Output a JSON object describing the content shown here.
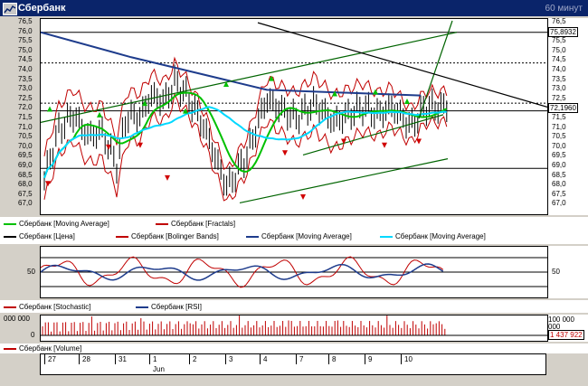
{
  "window": {
    "title": "Сбербанк",
    "timeframe": "60 минут"
  },
  "price_panel": {
    "y_ticks": [
      "76,5",
      "76,0",
      "75,5",
      "75,0",
      "74,5",
      "74,0",
      "73,5",
      "73,0",
      "72,5",
      "72,0",
      "71,5",
      "71,0",
      "70,5",
      "70,0",
      "69,5",
      "69,0",
      "68,5",
      "68,0",
      "67,5",
      "67,0"
    ],
    "left_ticks": [
      "76,5",
      "76,0",
      "75,5",
      "75,0",
      "74,5",
      "74,0",
      "73,5",
      "73,0",
      "72,5",
      "72,0",
      "71,5",
      "71,0",
      "70,5",
      "70,0",
      "69,5",
      "69,0",
      "68,5",
      "68,0",
      "67,5",
      "67,0"
    ],
    "last_price_top": "75,8932",
    "last_price": "72,1960"
  },
  "legend": [
    {
      "label": "Сбербанк [Moving Average]",
      "color": "#00c000"
    },
    {
      "label": "Сбербанк [Fractals]",
      "color": "#c00000"
    },
    {
      "label": "Сбербанк [Цена]",
      "color": "#000000"
    },
    {
      "label": "Сбербанк [Bolinger Bands]",
      "color": "#c00000"
    },
    {
      "label": "Сбербанк [Moving Average]",
      "color": "#1e3c8c"
    },
    {
      "label": "Сбербанк [Moving Average]",
      "color": "#00d8ff"
    }
  ],
  "oscillator_panel": {
    "tick": "50",
    "right_tick": "50",
    "legend": [
      {
        "label": "Сбербанк [Stochastic]",
        "color": "#c00000"
      },
      {
        "label": "Сбербанк [RSI]",
        "color": "#1e3c8c"
      }
    ]
  },
  "volume_panel": {
    "left_top": "000 000",
    "left_zero": "0",
    "right_top": "100 000 000",
    "right_zero": "0",
    "last_value": "1 437 922",
    "legend": [
      {
        "label": "Сбербанк [Volume]",
        "color": "#c00000"
      }
    ]
  },
  "date_axis": {
    "days": [
      "27",
      "28",
      "31",
      "1",
      "2",
      "3",
      "4",
      "7",
      "8",
      "9",
      "10"
    ],
    "month": "Jun"
  },
  "colors": {
    "titlebar": "#0a246a",
    "ma_green": "#00c000",
    "ma_blue": "#1e3c8c",
    "ma_cyan": "#00d8ff",
    "bands": "#c00000",
    "trend": "#006400"
  }
}
